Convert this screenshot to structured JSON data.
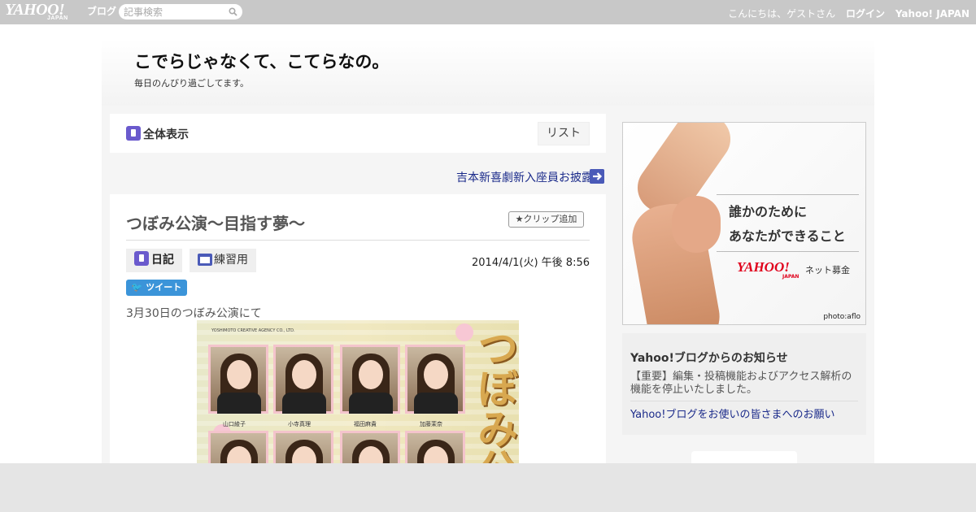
{
  "topbar": {
    "logo_text": "YAHOO!",
    "logo_sub": "JAPAN",
    "logo_blog": "ブログ",
    "search_placeholder": "記事検索",
    "greeting": "こんにちは、ゲストさん",
    "login": "ログイン",
    "yahoo_japan": "Yahoo! JAPAN"
  },
  "header": {
    "title": "こでらじゃなくて、こてらなの。",
    "subtitle": "毎日のんびり過ごしてます。"
  },
  "viewbar": {
    "view_all": "全体表示",
    "list": "リスト"
  },
  "prev_article": "吉本新喜劇新入座員お披露目",
  "article": {
    "title": "つぼみ公演～目指す夢～",
    "clip": "クリップ追加",
    "tag_diary": "日記",
    "tag_folder": "練習用",
    "date": "2014/4/1(火) 午後 8:56",
    "tweet": "ツイート",
    "text": "3月30日のつぼみ公演にて",
    "poster": {
      "agency": "YOSHIMOTO CREATIVE AGENCY CO., LTD.",
      "names": [
        "山口綾子",
        "小寺真理",
        "福田麻貴",
        "加藤茉奈"
      ],
      "big_text": "つぼみ公"
    }
  },
  "ad": {
    "copy1": "誰かのために",
    "copy2": "あなたができること",
    "logo": "YAHOO!",
    "logo_sub": "JAPAN",
    "fund": "ネット募金",
    "credit": "photo:aflo"
  },
  "notice": {
    "title": "Yahoo!ブログからのお知らせ",
    "body": "【重要】編集・投稿機能およびアクセス解析の機能を停止いたしました。",
    "link": "Yahoo!ブログをお使いの皆さまへのお願い"
  },
  "colors": {
    "topbar": "#c8c8c8",
    "link": "#1a2a8a",
    "accent_blue": "#4a5ab8",
    "tweet": "#3b94d9"
  }
}
